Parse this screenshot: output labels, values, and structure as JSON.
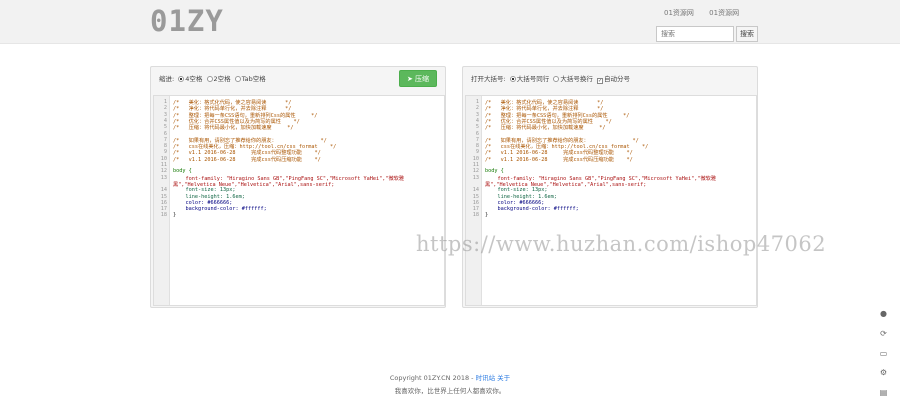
{
  "header": {
    "logo": "01ZY",
    "links": [
      "01资源网",
      "01资源网"
    ],
    "search_placeholder": "搜索",
    "search_button": "搜索"
  },
  "left_panel": {
    "label": "缩进:",
    "options": [
      "4空格",
      "2空格",
      "Tab空格"
    ],
    "selected": "4空格",
    "button": "压缩"
  },
  "right_panel": {
    "label": "打开大括号:",
    "options": [
      "大括号同行",
      "大括号换行"
    ],
    "selected": "大括号同行",
    "checkbox": "自动分号",
    "checked": true
  },
  "left_code": [
    {
      "n": "1",
      "t": "/*   美化：格式化代码，使之容易阅读      */",
      "c": "c-com"
    },
    {
      "n": "2",
      "t": "/*   净化：将代码单行化，并去除注释      */",
      "c": "c-com"
    },
    {
      "n": "3",
      "t": "/*   整理：把每一条CSS语句，重新排列Css的属性     */",
      "c": "c-com"
    },
    {
      "n": "4",
      "t": "/*   优化：合并CSS属性值以及为简写的属性    */",
      "c": "c-com"
    },
    {
      "n": "5",
      "t": "/*   压缩：将代码最小化，加快加载速度     */",
      "c": "c-com"
    },
    {
      "n": "6",
      "t": "",
      "c": "c-plain"
    },
    {
      "n": "7",
      "t": "/*   如果有用，请别忘了推荐给你的朋友：              */",
      "c": "c-com"
    },
    {
      "n": "8",
      "t": "/*   css在线美化，压缩：http://tool.cn/css_format    */",
      "c": "c-com"
    },
    {
      "n": "9",
      "t": "/*   v1.1 2016-06-28     完成css代码整理功能    */",
      "c": "c-com"
    },
    {
      "n": "10",
      "t": "/*   v1.1 2016-06-28     完成css代码压缩功能    */",
      "c": "c-com"
    },
    {
      "n": "11",
      "t": "",
      "c": "c-plain"
    },
    {
      "n": "12",
      "t": "body {",
      "c": "c-sel"
    },
    {
      "n": "13",
      "t": "    font-family: \"Hiragino Sans GB\",\"PingFang SC\",\"Microsoft YaHei\",\"微软雅",
      "c": "c-str"
    },
    {
      "n": "",
      "t": "黑\",\"Helvetica Neue\",\"Helvetica\",\"Arial\",sans-serif;",
      "c": "c-str"
    },
    {
      "n": "14",
      "t": "    font-size: 13px;",
      "c": "c-num"
    },
    {
      "n": "15",
      "t": "    line-height: 1.6em;",
      "c": "c-num"
    },
    {
      "n": "16",
      "t": "    color: #666666;",
      "c": "c-prop"
    },
    {
      "n": "17",
      "t": "    background-color: #ffffff;",
      "c": "c-prop"
    },
    {
      "n": "18",
      "t": "}",
      "c": "c-plain"
    }
  ],
  "right_code": [
    {
      "n": "1",
      "t": "/*   美化：格式化代码，使之容易阅读      */",
      "c": "c-com"
    },
    {
      "n": "2",
      "t": "/*   净化：将代码单行化，并去除注释      */",
      "c": "c-com"
    },
    {
      "n": "3",
      "t": "/*   整理：把每一条CSS语句，重新排列Css的属性     */",
      "c": "c-com"
    },
    {
      "n": "4",
      "t": "/*   优化：合并CSS属性值以及为简写的属性    */",
      "c": "c-com"
    },
    {
      "n": "5",
      "t": "/*   压缩：将代码最小化，加快加载速度     */",
      "c": "c-com"
    },
    {
      "n": "6",
      "t": "",
      "c": "c-plain"
    },
    {
      "n": "7",
      "t": "/*   如果有用，请别忘了推荐给你的朋友：              */",
      "c": "c-com"
    },
    {
      "n": "8",
      "t": "/*   css在线美化，压缩：http://tool.cn/css_format    */",
      "c": "c-com"
    },
    {
      "n": "9",
      "t": "/*   v1.1 2016-06-28     完成css代码整理功能    */",
      "c": "c-com"
    },
    {
      "n": "10",
      "t": "/*   v1.1 2016-06-28     完成css代码压缩功能    */",
      "c": "c-com"
    },
    {
      "n": "11",
      "t": "",
      "c": "c-plain"
    },
    {
      "n": "12",
      "t": "body {",
      "c": "c-sel"
    },
    {
      "n": "13",
      "t": "    font-family: \"Hiragino Sans GB\",\"PingFang SC\",\"Microsoft YaHei\",\"微软雅",
      "c": "c-str"
    },
    {
      "n": "",
      "t": "黑\",\"Helvetica Neue\",\"Helvetica\",\"Arial\",sans-serif;",
      "c": "c-str"
    },
    {
      "n": "14",
      "t": "    font-size: 13px;",
      "c": "c-num"
    },
    {
      "n": "15",
      "t": "    line-height: 1.6em;",
      "c": "c-num"
    },
    {
      "n": "16",
      "t": "    color: #666666;",
      "c": "c-prop"
    },
    {
      "n": "17",
      "t": "    background-color: #ffffff;",
      "c": "c-prop"
    },
    {
      "n": "18",
      "t": "}",
      "c": "c-plain"
    }
  ],
  "watermark": "https://www.huzhan.com/ishop47062",
  "footer": {
    "copyright": "Copyright 01ZY.CN 2018 - ",
    "links": "时讯站 关于",
    "note": "我喜欢你，比世界上任何人都喜欢你。"
  },
  "side_icons": [
    "bell-icon",
    "share-icon",
    "monitor-icon",
    "gear-icon",
    "print-icon"
  ],
  "colors": {
    "accent": "#5cb85c",
    "link": "#2a7ae2"
  }
}
